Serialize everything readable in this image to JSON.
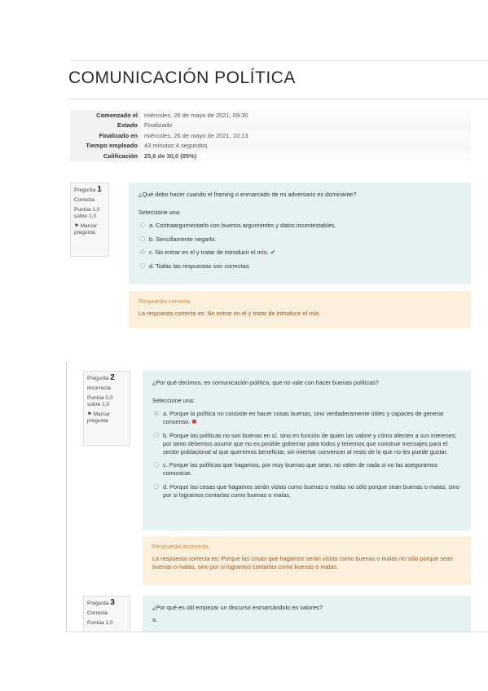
{
  "course_title": "COMUNICACIÓN POLÍTICA",
  "summary": [
    {
      "label": "Comenzado el",
      "value": "miércoles, 26 de mayo de 2021, 09:30"
    },
    {
      "label": "Estado",
      "value": "Finalizado"
    },
    {
      "label": "Finalizado en",
      "value": "miércoles, 26 de mayo de 2021, 10:13"
    },
    {
      "label": "Tiempo empleado",
      "value": "43 minutos 4 segundos"
    },
    {
      "label": "Calificación",
      "value": "25,6 de 30,0 (85%)"
    }
  ],
  "questions": [
    {
      "label": "Pregunta",
      "number": "1",
      "state": "Correcta",
      "score": "Puntúa 1,0 sobre 1,0",
      "flag": "Marcar pregunta",
      "text": "¿Qué debo hacer cuando el framing o enmarcado de mi adversario es dominante?",
      "prompt": "Seleccione una:",
      "options": [
        "a. Contraargumentarlo con buenos argumentos y datos incontestables.",
        "b. Sencillamente negarlo.",
        "c. No entrar en el y tratar de introducir el mío.",
        "d. Todas las respuestas son correctas."
      ],
      "feedback_status": "Respuesta correcta",
      "feedback_text": "La respuesta correcta es: No entrar en el y tratar de introducir el mío."
    },
    {
      "label": "Pregunta",
      "number": "2",
      "state": "Incorrecta",
      "score": "Puntúa 0,0 sobre 1,0",
      "flag": "Marcar pregunta",
      "text": "¿Por qué decimos, en comunicación política, que no vale con hacer buenas políticas?",
      "prompt": "Seleccione una:",
      "options": [
        "a. Porque la política no consiste en hacer cosas buenas, sino verdaderamente útiles y capaces de generar consenso.",
        "b. Porque las políticas no son buenas en sí, sino en función de quien las valore y cómo afecten a sus intereses; por tanto debemos asumir que no es posible gobernar para todos y tenemos que construir mensajes para el sector poblacional al que queremos beneficiar, sin intentar convencer al resto de lo que no les puede gustar.",
        "c. Porque las políticas que hagamos, por muy buenas que sean, no valen de nada si no las aseguramos comunicar.",
        "d. Porque las cosas que hagamos serán vistas como buenas o malas no sólo porque sean buenas o malas, sino por si logramos contarlas como buenas o malas."
      ],
      "feedback_status": "Respuesta incorrecta.",
      "feedback_text": "La respuesta correcta es: Porque las cosas que hagamos serán vistas como buenas o malas no sólo porque sean buenas o malas, sino por si logramos contarlas como buenas o malas."
    },
    {
      "label": "Pregunta",
      "number": "3",
      "state": "Correcta",
      "score": "Puntúa 1,0",
      "text": "¿Por qué es útil empezar un discurso enmarcándolo en valores?",
      "option_start": "a."
    }
  ],
  "icons": {
    "correct": "check-icon",
    "incorrect": "cross-icon"
  },
  "colors": {
    "question_bg": "#e6f1f2",
    "feedback_bg": "#fcefdc",
    "correct": "#3a8d3a",
    "incorrect": "#cc2222"
  }
}
